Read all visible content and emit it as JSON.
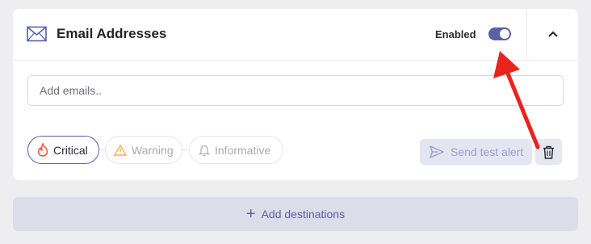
{
  "card": {
    "title": "Email Addresses",
    "icon": "mail-icon",
    "enabled_label": "Enabled",
    "toggle_on": true
  },
  "email_input": {
    "placeholder": "Add emails..",
    "value": ""
  },
  "severity": {
    "critical": "Critical",
    "warning": "Warning",
    "informative": "Informative"
  },
  "actions": {
    "send_test": "Send test alert"
  },
  "footer": {
    "add_destinations": "Add destinations"
  },
  "colors": {
    "accent": "#5a5fa8",
    "annotation_arrow": "#e8241c",
    "critical_icon": "#e8502e",
    "warning_icon": "#f2b24a"
  }
}
